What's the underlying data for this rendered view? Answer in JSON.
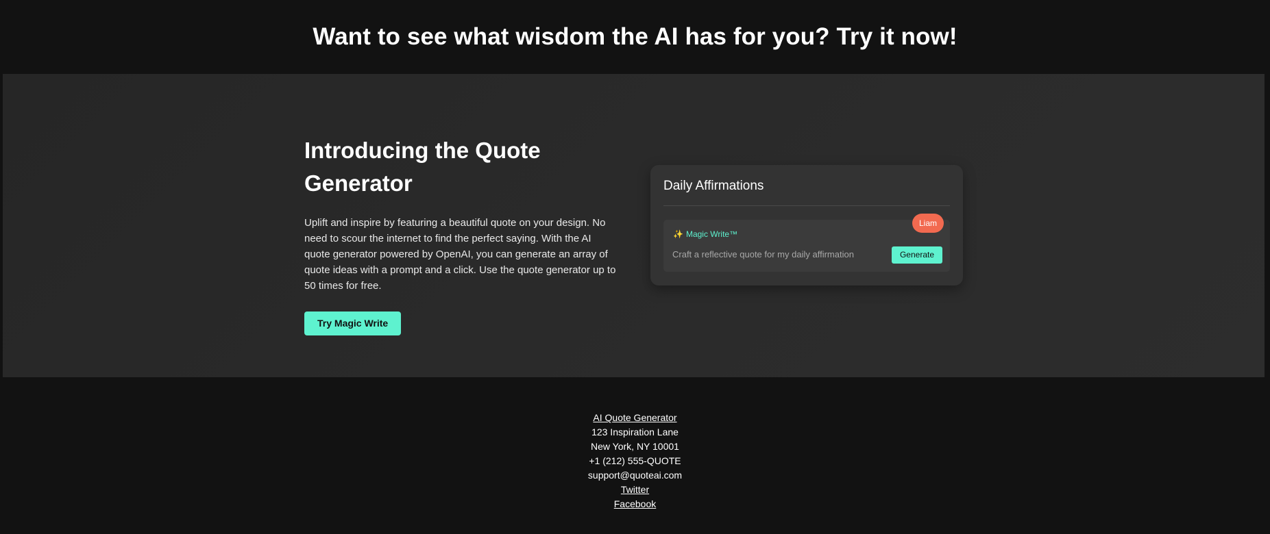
{
  "banner": {
    "heading": "Want to see what wisdom the AI has for you? Try it now!"
  },
  "hero": {
    "title_line1": "Introducing the Quote",
    "title_line2": "Generator",
    "description": "Uplift and inspire by featuring a beautiful quote on your design. No need to scour the internet to find the perfect saying. With the AI quote generator powered by OpenAI, you can generate an array of quote ideas with a prompt and a click. Use the quote generator up to 50 times for free.",
    "cta_label": "Try Magic Write"
  },
  "card": {
    "title": "Daily Affirmations",
    "magic_label": "Magic Write™",
    "prompt": "Craft a reflective quote for my daily affirmation",
    "generate_label": "Generate",
    "user_pill": "Liam"
  },
  "footer": {
    "company_link": "AI Quote Generator",
    "address_line1": "123 Inspiration Lane",
    "address_line2": "New York, NY 10001",
    "phone": "+1 (212) 555-QUOTE",
    "email": "support@quoteai.com",
    "twitter": "Twitter",
    "facebook": "Facebook"
  },
  "colors": {
    "background": "#121212",
    "hero_bg": "#2a2a2a",
    "accent": "#5ef2cf",
    "user_pill": "#f26a50"
  },
  "icons": {
    "magic": "sparkle-icon"
  }
}
